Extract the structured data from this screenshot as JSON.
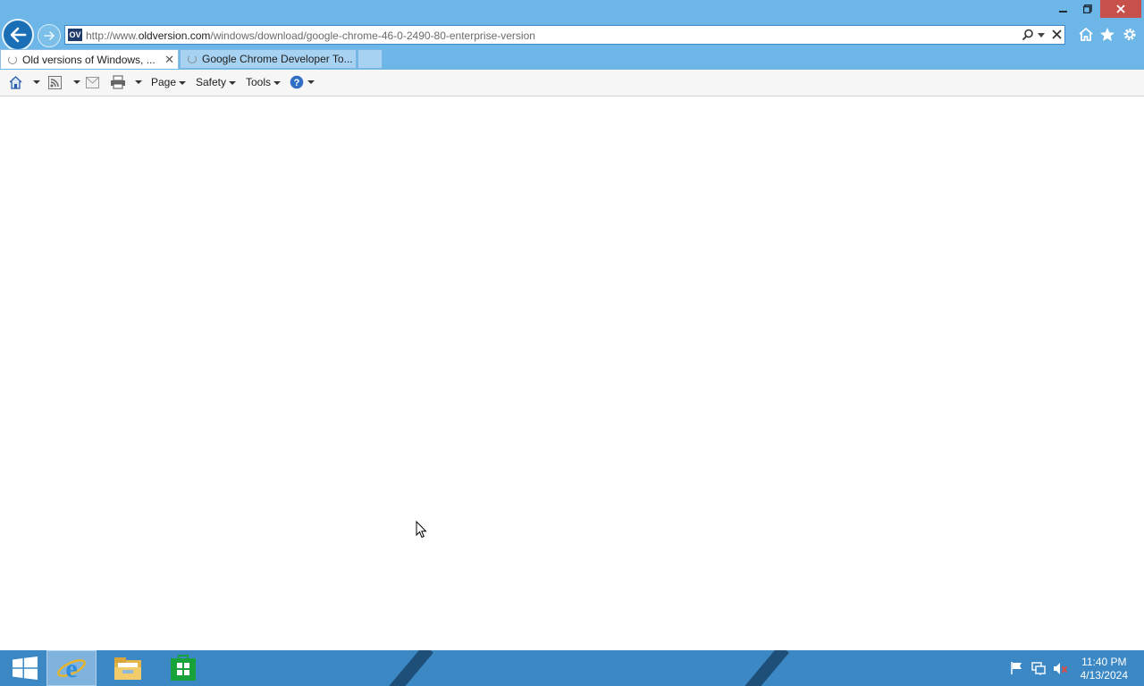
{
  "browser": {
    "address_url_prefix": "http://www.",
    "address_url_domain": "oldversion.com",
    "address_url_path": "/windows/download/google-chrome-46-0-2490-80-enterprise-version",
    "favicon_text": "OV"
  },
  "tabs": [
    {
      "label": "Old versions of Windows, ...",
      "active": true
    },
    {
      "label": "Google Chrome Developer To...",
      "active": false
    }
  ],
  "command_bar": {
    "page_label": "Page",
    "safety_label": "Safety",
    "tools_label": "Tools"
  },
  "taskbar": {
    "time": "11:40 PM",
    "date": "4/13/2024",
    "pinned": [
      "start-icon",
      "internet-explorer-icon",
      "file-explorer-icon",
      "store-icon"
    ]
  },
  "colors": {
    "title_bar": "#6cb6e8",
    "close_button": "#c7504b",
    "taskbar": "#3b88c4"
  }
}
